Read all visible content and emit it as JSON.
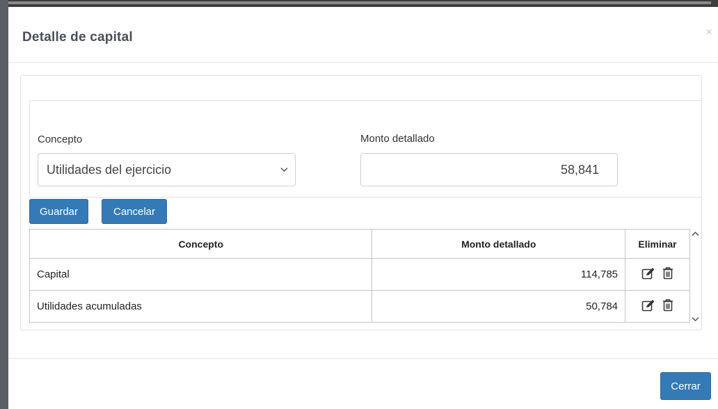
{
  "modal": {
    "title": "Detalle de capital",
    "close_label": "×"
  },
  "form": {
    "concepto_label": "Concepto",
    "concepto_selected": "Utilidades del ejercicio",
    "monto_label": "Monto detallado",
    "monto_value": "58,841"
  },
  "buttons": {
    "guardar": "Guardar",
    "cancelar": "Cancelar",
    "cerrar": "Cerrar"
  },
  "table": {
    "headers": [
      "Concepto",
      "Monto detallado",
      "Eliminar"
    ],
    "rows": [
      {
        "concepto": "Capital",
        "monto": "114,785"
      },
      {
        "concepto": "Utilidades acumuladas",
        "monto": "50,784"
      }
    ]
  },
  "colors": {
    "primary": "#337ab7",
    "border": "#dde2e6"
  }
}
